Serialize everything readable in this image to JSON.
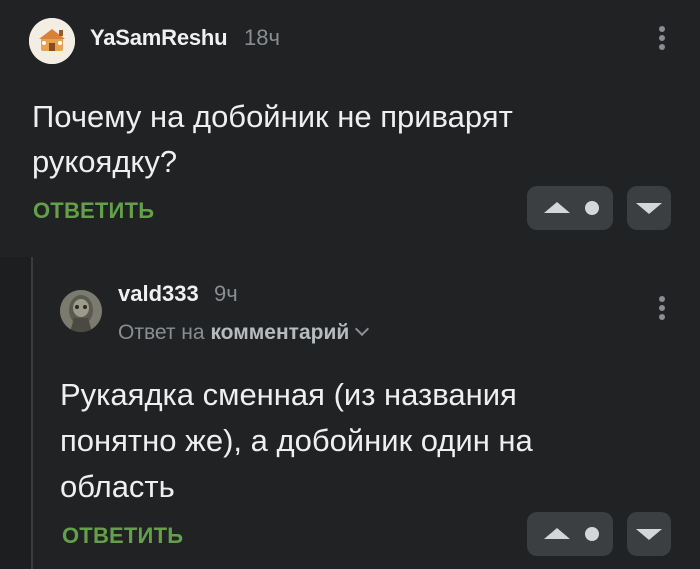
{
  "colors": {
    "background": "#202224",
    "accent_green": "#64a04a",
    "muted_text": "#8a8e92",
    "button_bg": "#3b3f42"
  },
  "comments": [
    {
      "author": "YaSamReshu",
      "time": "18ч",
      "text": "Почему на добойник не приварят рукоядку?",
      "reply_label": "ОТВЕТИТЬ",
      "avatar_icon": "house-cartoon-avatar"
    },
    {
      "author": "vald333",
      "time": "9ч",
      "reply_to_prefix": "Ответ на",
      "reply_to_target": "комментарий",
      "text": "Рукаядка сменная (из названия понятно же), а добойник один на область",
      "reply_label": "ОТВЕТИТЬ",
      "avatar_icon": "creature-photo-avatar"
    }
  ]
}
